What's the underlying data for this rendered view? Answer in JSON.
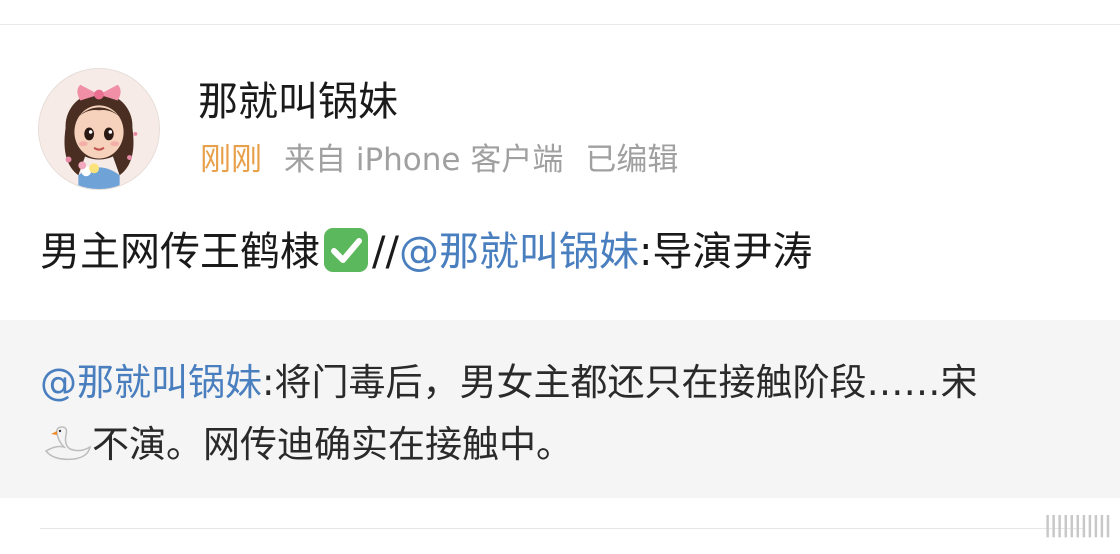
{
  "post": {
    "username": "那就叫锅妹",
    "time": "刚刚",
    "source": "来自 iPhone 客户端",
    "edited": "已编辑",
    "text_main": "男主网传王鹤棣",
    "check_icon": "white-check-mark-icon",
    "text_slashes": "//",
    "mention": "@那就叫锅妹",
    "text_after_mention": ":导演尹涛"
  },
  "repost": {
    "mention": "@那就叫锅妹",
    "text_before_emoji": ":将门毒后，男女主都还只在接触阶段……宋",
    "swan_icon": "swan-icon",
    "text_after_emoji": "不演。网传迪确实在接触中。"
  },
  "watermark": "|||||||||||",
  "colors": {
    "time": "#e8a04a",
    "mention": "#4a7fbf",
    "meta": "#a0a0a0",
    "repost_bg": "#f5f5f5",
    "check_bg": "#5cb85c"
  }
}
